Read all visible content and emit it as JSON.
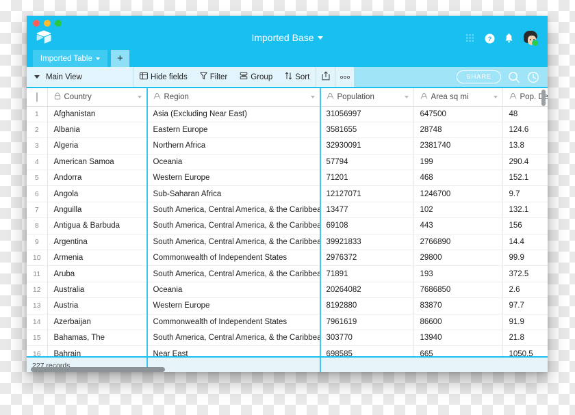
{
  "window": {
    "traffic_lights": [
      "close",
      "minimize",
      "zoom"
    ],
    "logo_name": "airtable-logo",
    "base_title": "Imported Base"
  },
  "header": {
    "icons": [
      "apps-grid-icon",
      "help-icon",
      "bell-icon",
      "avatar"
    ]
  },
  "tabs": {
    "items": [
      {
        "label": "Imported Table"
      }
    ],
    "add_label": "+"
  },
  "toolbar": {
    "view_name": "Main View",
    "hide_fields_label": "Hide fields",
    "filter_label": "Filter",
    "group_label": "Group",
    "sort_label": "Sort",
    "share_label": "SHARE"
  },
  "grid": {
    "columns": [
      {
        "key": "num",
        "label": "",
        "icon": "checkbox"
      },
      {
        "key": "country",
        "label": "Country",
        "icon": "lock-icon"
      },
      {
        "key": "region",
        "label": "Region",
        "icon": "text-field-icon"
      },
      {
        "key": "pop",
        "label": "Population",
        "icon": "text-field-icon"
      },
      {
        "key": "area",
        "label": "Area sq mi",
        "icon": "text-field-icon"
      },
      {
        "key": "density",
        "label": "Pop. De",
        "icon": "text-field-icon"
      }
    ],
    "rows": [
      {
        "n": "1",
        "country": "Afghanistan",
        "region": "Asia (Excluding Near East)",
        "pop": "31056997",
        "area": "647500",
        "density": "48"
      },
      {
        "n": "2",
        "country": "Albania",
        "region": "Eastern Europe",
        "pop": "3581655",
        "area": "28748",
        "density": "124.6"
      },
      {
        "n": "3",
        "country": "Algeria",
        "region": "Northern Africa",
        "pop": "32930091",
        "area": "2381740",
        "density": "13.8"
      },
      {
        "n": "4",
        "country": "American Samoa",
        "region": "Oceania",
        "pop": "57794",
        "area": "199",
        "density": "290.4"
      },
      {
        "n": "5",
        "country": "Andorra",
        "region": "Western Europe",
        "pop": "71201",
        "area": "468",
        "density": "152.1"
      },
      {
        "n": "6",
        "country": "Angola",
        "region": "Sub-Saharan Africa",
        "pop": "12127071",
        "area": "1246700",
        "density": "9.7"
      },
      {
        "n": "7",
        "country": "Anguilla",
        "region": "South America, Central America, & the Caribbean",
        "pop": "13477",
        "area": "102",
        "density": "132.1"
      },
      {
        "n": "8",
        "country": "Antigua & Barbuda",
        "region": "South America, Central America, & the Caribbean",
        "pop": "69108",
        "area": "443",
        "density": "156"
      },
      {
        "n": "9",
        "country": "Argentina",
        "region": "South America, Central America, & the Caribbean",
        "pop": "39921833",
        "area": "2766890",
        "density": "14.4"
      },
      {
        "n": "10",
        "country": "Armenia",
        "region": "Commonwealth of Independent States",
        "pop": "2976372",
        "area": "29800",
        "density": "99.9"
      },
      {
        "n": "11",
        "country": "Aruba",
        "region": "South America, Central America, & the Caribbean",
        "pop": "71891",
        "area": "193",
        "density": "372.5"
      },
      {
        "n": "12",
        "country": "Australia",
        "region": "Oceania",
        "pop": "20264082",
        "area": "7686850",
        "density": "2.6"
      },
      {
        "n": "13",
        "country": "Austria",
        "region": "Western Europe",
        "pop": "8192880",
        "area": "83870",
        "density": "97.7"
      },
      {
        "n": "14",
        "country": "Azerbaijan",
        "region": "Commonwealth of Independent States",
        "pop": "7961619",
        "area": "86600",
        "density": "91.9"
      },
      {
        "n": "15",
        "country": "Bahamas, The",
        "region": "South America, Central America, & the Caribbean",
        "pop": "303770",
        "area": "13940",
        "density": "21.8"
      },
      {
        "n": "16",
        "country": "Bahrain",
        "region": "Near East",
        "pop": "698585",
        "area": "665",
        "density": "1050.5"
      }
    ]
  },
  "footer": {
    "record_count": "227 records"
  },
  "colors": {
    "brand": "#18bfef",
    "tab_active": "#3fcbf2",
    "toolbar": "#9fe4f7",
    "toolbar_panel": "#e2f5fc",
    "cyan_line": "#3dc7ee",
    "footer": "#e6f4fa"
  }
}
